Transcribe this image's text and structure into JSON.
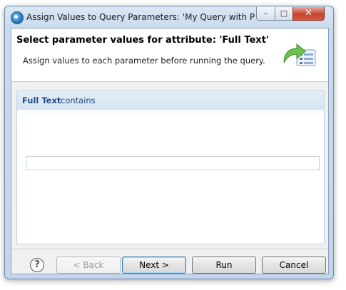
{
  "window": {
    "title": "Assign Values to Query Parameters: 'My Query with Para...",
    "minimize_glyph": "–",
    "maximize_glyph": "□",
    "close_glyph": "✕"
  },
  "banner": {
    "title": "Select parameter values for attribute: 'Full Text'",
    "description": "Assign values to each parameter before running the query."
  },
  "parameter": {
    "attribute": "Full Text",
    "operator": "contains",
    "value": ""
  },
  "footer": {
    "help_glyph": "?",
    "back_label": "< Back",
    "next_label": "Next >",
    "run_label": "Run",
    "cancel_label": "Cancel"
  },
  "icons": {
    "app": "eclipse-app-icon",
    "help": "help-icon",
    "wizard": "wizard-arrow-list-icon"
  },
  "colors": {
    "accent": "#1f4f86",
    "close_button": "#c8422c"
  }
}
